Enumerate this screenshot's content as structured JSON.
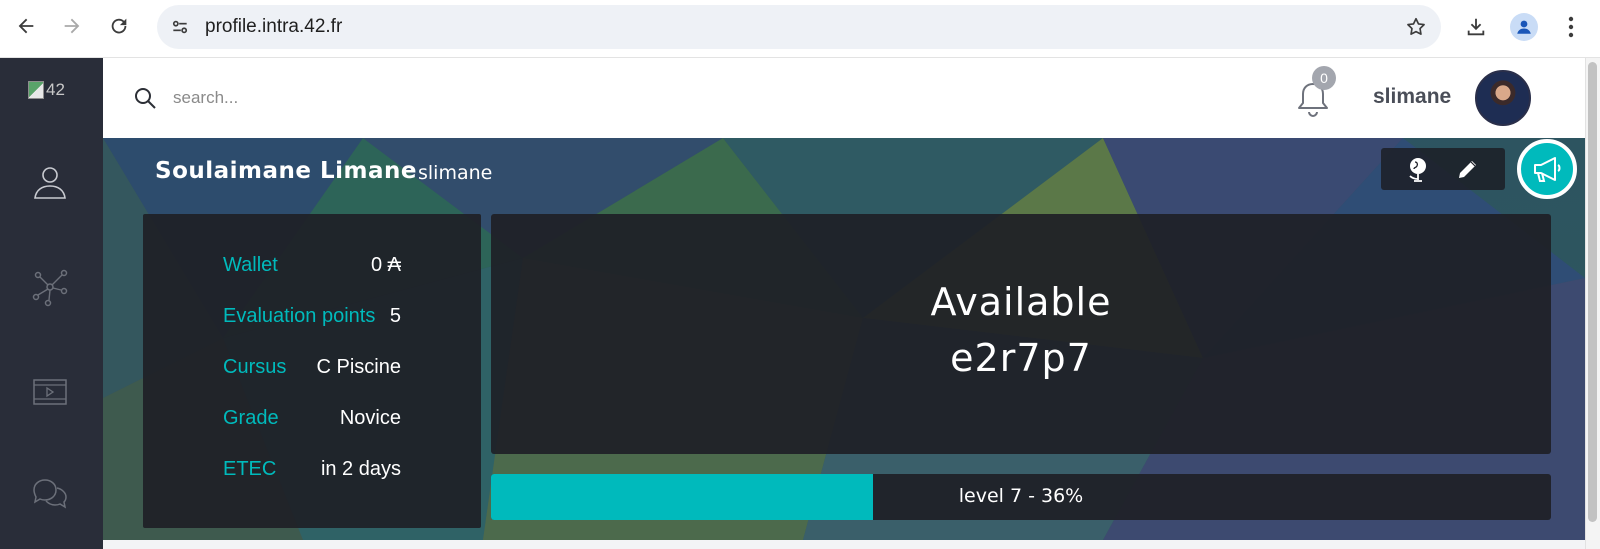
{
  "browser": {
    "url": "profile.intra.42.fr"
  },
  "sidebar": {
    "logo_alt": "42",
    "items": [
      {
        "name": "profile"
      },
      {
        "name": "network"
      },
      {
        "name": "videos"
      },
      {
        "name": "chat"
      }
    ]
  },
  "header": {
    "search_placeholder": "search...",
    "notifications_count": "0",
    "username": "slimane"
  },
  "profile": {
    "full_name": "Soulaimane Limane",
    "login": "slimane",
    "info": [
      {
        "label": "Wallet",
        "value": "0 ₳"
      },
      {
        "label": "Evaluation points",
        "value": "5"
      },
      {
        "label": "Cursus",
        "value": "C Piscine"
      },
      {
        "label": "Grade",
        "value": "Novice"
      },
      {
        "label": "ETEC",
        "value": "in 2 days"
      }
    ],
    "location_status": "Available",
    "location_host": "e2r7p7",
    "level_text": "level 7 - 36%",
    "level_progress": 0.36
  },
  "colors": {
    "accent": "#00babc",
    "sidebar": "#292d39",
    "panel": "#1e1f26"
  }
}
